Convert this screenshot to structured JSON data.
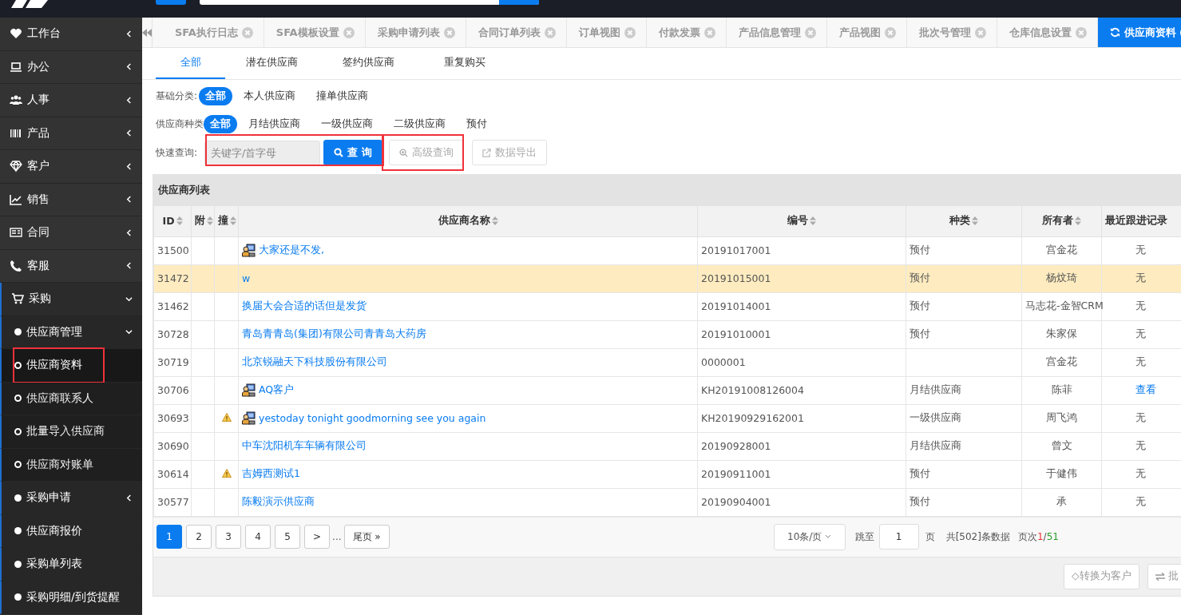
{
  "tabs": [
    {
      "label": "SFA执行日志",
      "selected": false
    },
    {
      "label": "SFA模板设置",
      "selected": false
    },
    {
      "label": "采购申请列表",
      "selected": false
    },
    {
      "label": "合同订单列表",
      "selected": false
    },
    {
      "label": "订单视图",
      "selected": false
    },
    {
      "label": "付款发票",
      "selected": false
    },
    {
      "label": "产品信息管理",
      "selected": false
    },
    {
      "label": "产品视图",
      "selected": false
    },
    {
      "label": "批次号管理",
      "selected": false
    },
    {
      "label": "仓库信息设置",
      "selected": false
    },
    {
      "label": "供应商资料",
      "selected": true
    }
  ],
  "sidebar": {
    "items": [
      {
        "label": "工作台",
        "expanded": false
      },
      {
        "label": "办公",
        "expanded": false
      },
      {
        "label": "人事",
        "expanded": false
      },
      {
        "label": "产品",
        "expanded": false
      },
      {
        "label": "客户",
        "expanded": false
      },
      {
        "label": "销售",
        "expanded": false
      },
      {
        "label": "合同",
        "expanded": false
      },
      {
        "label": "客服",
        "expanded": false
      },
      {
        "label": "采购",
        "expanded": true,
        "children": [
          {
            "label": "供应商管理",
            "expanded": true,
            "children": [
              {
                "label": "供应商资料",
                "selected": true
              },
              {
                "label": "供应商联系人",
                "selected": false
              },
              {
                "label": "批量导入供应商",
                "selected": false
              },
              {
                "label": "供应商对账单",
                "selected": false
              }
            ]
          },
          {
            "label": "采购申请",
            "expanded": false
          },
          {
            "label": "供应商报价"
          },
          {
            "label": "采购单列表"
          },
          {
            "label": "采购明细/到货提醒"
          }
        ]
      }
    ]
  },
  "sub_tabs": [
    {
      "label": "全部",
      "selected": true
    },
    {
      "label": "潜在供应商",
      "selected": false
    },
    {
      "label": "签约供应商",
      "selected": false
    },
    {
      "label": "重复购买",
      "selected": false
    }
  ],
  "filters": [
    {
      "label": "基础分类:",
      "options": [
        {
          "label": "全部",
          "selected": true
        },
        {
          "label": "本人供应商",
          "selected": false
        },
        {
          "label": "撞单供应商",
          "selected": false
        }
      ]
    },
    {
      "label": "供应商种类",
      "options": [
        {
          "label": "全部",
          "selected": true
        },
        {
          "label": "月结供应商",
          "selected": false
        },
        {
          "label": "一级供应商",
          "selected": false
        },
        {
          "label": "二级供应商",
          "selected": false
        },
        {
          "label": "预付",
          "selected": false
        }
      ]
    }
  ],
  "quick_search": {
    "label": "快速查询:",
    "placeholder": "关键字/首字母",
    "search_button": "查 询",
    "advanced_button": "高级查询",
    "export_button": "数据导出"
  },
  "table": {
    "title": "供应商列表",
    "columns": [
      "ID",
      "附",
      "撞",
      "供应商名称",
      "编号",
      "种类",
      "所有者",
      "最近跟进记录"
    ],
    "rows": [
      {
        "id": "31500",
        "warning": false,
        "icon": true,
        "name": "大家还是不发,",
        "code": "20191017001",
        "type": "预付",
        "owner": "宫金花",
        "last": {
          "text": "无",
          "kind": "text"
        },
        "selected": false
      },
      {
        "id": "31472",
        "warning": false,
        "icon": false,
        "name": "w",
        "code": "20191015001",
        "type": "预付",
        "owner": "杨炆琦",
        "last": {
          "text": "无",
          "kind": "text"
        },
        "selected": true
      },
      {
        "id": "31462",
        "warning": false,
        "icon": false,
        "name": "换届大会合适的话但是发货",
        "code": "20191014001",
        "type": "预付",
        "owner": "马志花-金智CRM",
        "last": {
          "text": "无",
          "kind": "text"
        },
        "selected": false
      },
      {
        "id": "30728",
        "warning": false,
        "icon": false,
        "name": "青岛青青岛(集团)有限公司青青岛大药房",
        "code": "20191010001",
        "type": "预付",
        "owner": "朱家保",
        "last": {
          "text": "无",
          "kind": "text"
        },
        "selected": false
      },
      {
        "id": "30719",
        "warning": false,
        "icon": false,
        "name": "北京锐融天下科技股份有限公司",
        "code": "0000001",
        "owner": "宫金花",
        "last": {
          "text": "无",
          "kind": "text"
        },
        "selected": false
      },
      {
        "id": "30706",
        "warning": false,
        "icon": true,
        "name": "AQ客户",
        "code": "KH20191008126004",
        "type": "月结供应商",
        "owner": "陈菲",
        "last": {
          "text": "查看",
          "kind": "link"
        },
        "selected": false
      },
      {
        "id": "30693",
        "warning": true,
        "icon": true,
        "name": "yestoday tonight goodmorning see you again",
        "code": "KH20190929162001",
        "type": "一级供应商",
        "owner": "周飞鸿",
        "last": {
          "text": "无",
          "kind": "text"
        },
        "selected": false
      },
      {
        "id": "30690",
        "warning": false,
        "icon": false,
        "name": "中车沈阳机车车辆有限公司",
        "code": "20190928001",
        "type": "月结供应商",
        "owner": "曾文",
        "last": {
          "text": "无",
          "kind": "text"
        },
        "selected": false
      },
      {
        "id": "30614",
        "warning": true,
        "icon": false,
        "name": "吉姆西测试1",
        "code": "20190911001",
        "type": "预付",
        "owner": "于健伟",
        "last": {
          "text": "无",
          "kind": "text"
        },
        "selected": false
      },
      {
        "id": "30577",
        "warning": false,
        "icon": false,
        "name": "陈毅演示供应商",
        "code": "20190904001",
        "type": "预付",
        "owner": "承",
        "last": {
          "text": "无",
          "kind": "text"
        },
        "selected": false
      }
    ]
  },
  "pagination": {
    "pages": [
      {
        "label": "1",
        "selected": true
      },
      {
        "label": "2",
        "selected": false
      },
      {
        "label": "3",
        "selected": false
      },
      {
        "label": "4",
        "selected": false
      },
      {
        "label": "5",
        "selected": false
      }
    ],
    "next": ">",
    "ellipsis": "...",
    "last": "尾页 »",
    "page_size": "10条/页",
    "jump_label": "跳至",
    "jump_value": "1",
    "jump_unit": "页",
    "total": "共[502]条数据",
    "page_label": "页次",
    "current": "1",
    "separator": "/",
    "page_count": "51"
  },
  "footer_buttons": [
    {
      "label": "◇转换为客户",
      "kind": "plain"
    },
    {
      "label": "批",
      "kind": "swap"
    }
  ]
}
